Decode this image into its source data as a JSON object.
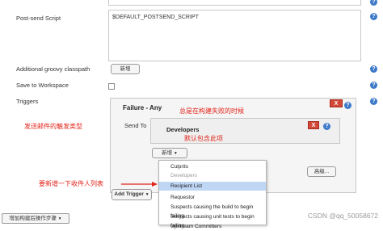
{
  "form": {
    "post_send_label": "Post-send Script",
    "post_send_value": "$DEFAULT_POSTSEND_SCRIPT",
    "groovy_label": "Additional groovy classpath",
    "groovy_add_button": "新增",
    "save_ws_label": "Save to Workspace",
    "triggers_label": "Triggers",
    "help_glyph": "?"
  },
  "trigger": {
    "title": "Failure - Any",
    "close_glyph": "X",
    "send_to_label": "Send To",
    "developers_title": "Developers",
    "add_button": "新增",
    "add_trigger_button": "Add Trigger",
    "advanced_button": "高级..."
  },
  "menu": {
    "items": [
      {
        "label": "Culprits"
      },
      {
        "label": "Developers"
      },
      {
        "label": "Recipient List"
      },
      {
        "label": "Requestor"
      },
      {
        "label": "Suspects causing the build to begin failing"
      },
      {
        "label": "Suspects causing unit tests to begin failing"
      },
      {
        "label": "Upstream Committers"
      }
    ]
  },
  "footer": {
    "add_post_build_button": "增加构建后操作步骤"
  },
  "annotations": {
    "trigger_type": "发送邮件的触发类型",
    "when_build_fails": "总是在构建失败的时候",
    "default_includes": "默认包含此项",
    "add_recipient_list": "要新增一下收件人列表"
  },
  "watermark": "CSDN @qq_50058672",
  "colors": {
    "annotation": "#e2231a",
    "help_icon": "#3d79c9",
    "close_button": "#d24939",
    "menu_selected": "#bfd6f4"
  }
}
